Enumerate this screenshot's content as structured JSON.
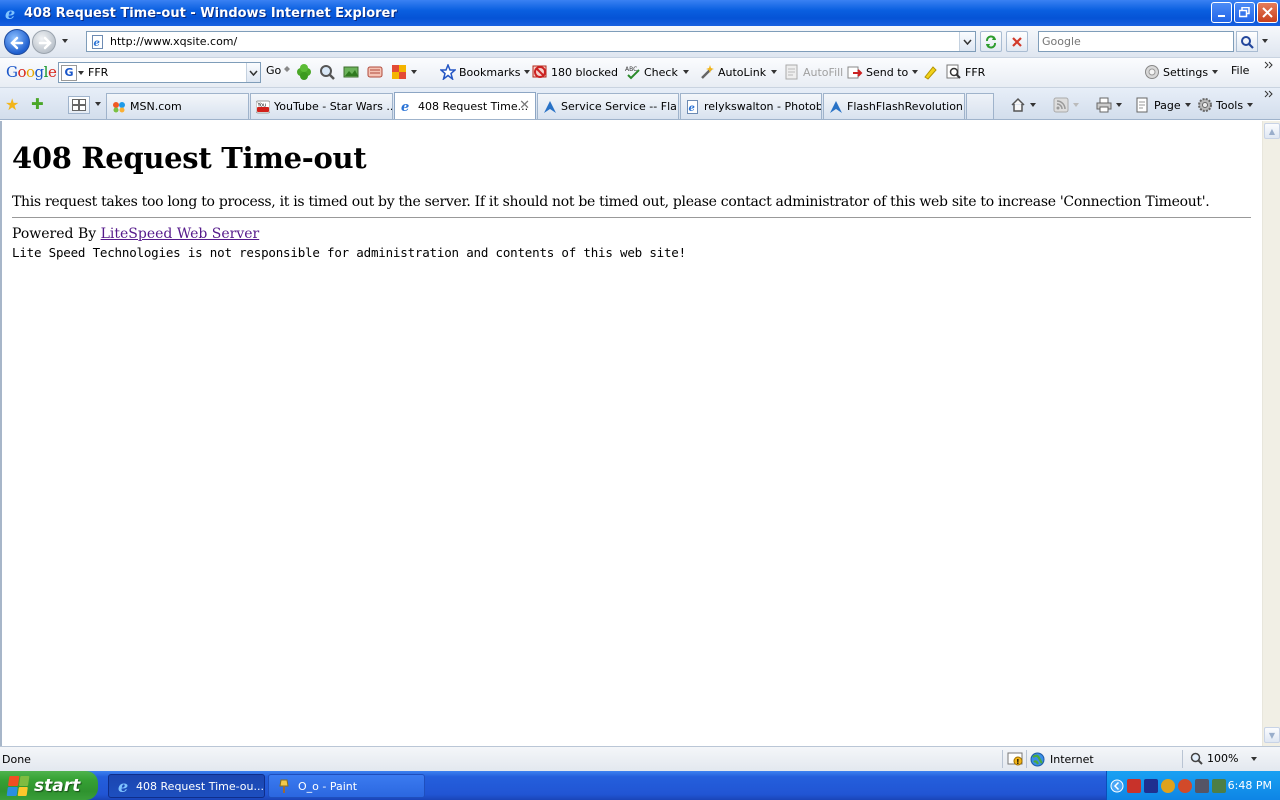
{
  "window": {
    "title": "408 Request Time-out - Windows Internet Explorer"
  },
  "address": {
    "url": "http://www.xqsite.com/",
    "search_placeholder": "Google"
  },
  "google_toolbar": {
    "logo": "Google",
    "search_value": "FFR",
    "go_label": "Go",
    "bookmarks_label": "Bookmarks",
    "blocked_label": "180 blocked",
    "check_label": "Check",
    "autolink_label": "AutoLink",
    "autofill_label": "AutoFill",
    "sendto_label": "Send to",
    "ffr_label": "FFR",
    "settings_label": "Settings",
    "file_label": "File"
  },
  "tabs": [
    {
      "label": "MSN.com"
    },
    {
      "label": "YouTube - Star Wars ..."
    },
    {
      "label": "408 Request Time..."
    },
    {
      "label": "Service Service -- Fla..."
    },
    {
      "label": "relykswalton - Photob..."
    },
    {
      "label": "FlashFlashRevolution..."
    }
  ],
  "command_bar": {
    "page_label": "Page",
    "tools_label": "Tools"
  },
  "page": {
    "heading": "408 Request Time-out",
    "message": "This request takes too long to process, it is timed out by the server. If it should not be timed out, please contact administrator of this web site to increase 'Connection Timeout'.",
    "powered_prefix": "Powered By",
    "powered_link": "LiteSpeed Web Server",
    "disclaimer": "Lite Speed Technologies is not responsible for administration and contents of this web site!"
  },
  "status": {
    "text": "Done",
    "zone": "Internet",
    "zoom": "100%"
  },
  "taskbar": {
    "start_label": "start",
    "tasks": [
      {
        "label": "408 Request Time-ou..."
      },
      {
        "label": "O_o - Paint"
      }
    ],
    "clock": "6:48 PM"
  }
}
